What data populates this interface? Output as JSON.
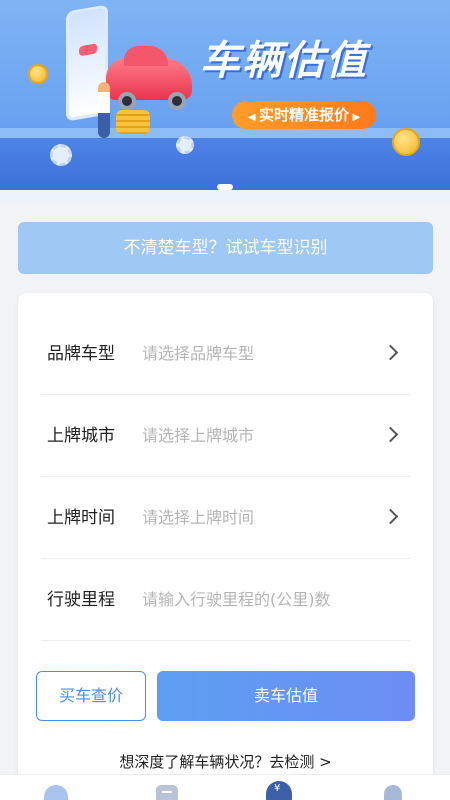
{
  "banner": {
    "title": "车辆估值",
    "subtitle_pill": "实时精准报价",
    "colors": {
      "background": "#6fa6f2",
      "pill": "#ff8c20",
      "title_shadow": "#3a6fd6"
    }
  },
  "hint": {
    "text": "不清楚车型？试试车型识别"
  },
  "form": {
    "rows": [
      {
        "label": "品牌车型",
        "placeholder": "请选择品牌车型"
      },
      {
        "label": "上牌城市",
        "placeholder": "请选择上牌城市"
      },
      {
        "label": "上牌时间",
        "placeholder": "请选择上牌时间"
      },
      {
        "label": "行驶里程",
        "placeholder": "请输入行驶里程的(公里)数"
      }
    ]
  },
  "actions": {
    "buy_label": "买车查价",
    "sell_label": "卖车估值",
    "detect_link": "想深度了解车辆状况？去检测 >"
  },
  "icons": [
    "chevron-right-icon",
    "home-tab-icon",
    "list-tab-icon",
    "car-value-tab-icon",
    "profile-tab-icon"
  ],
  "accent_color": "#4f8ee6"
}
